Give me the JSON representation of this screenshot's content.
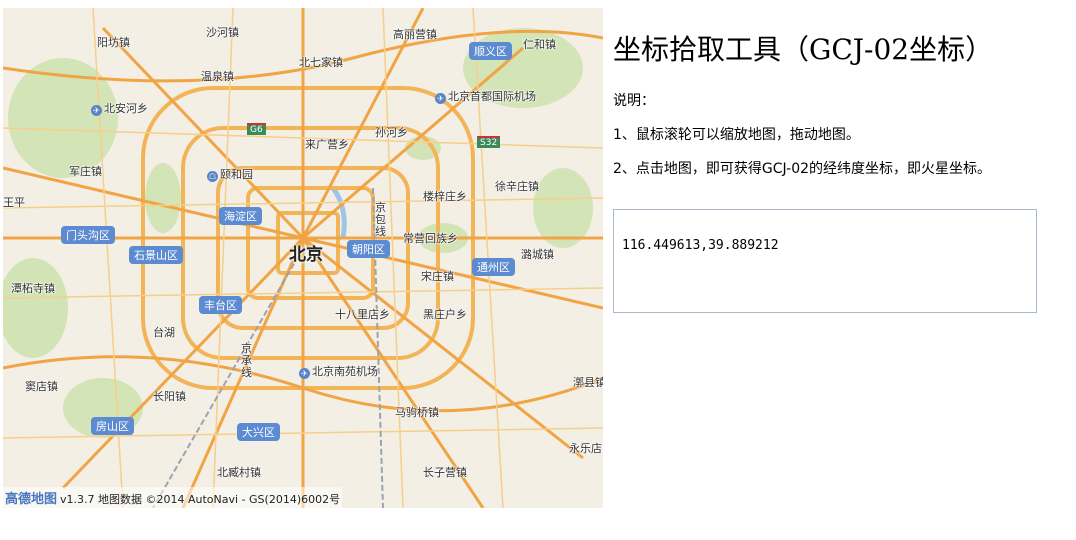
{
  "title": "坐标拾取工具（GCJ-02坐标）",
  "description": {
    "heading": "说明：",
    "line1": "1、鼠标滚轮可以缩放地图，拖动地图。",
    "line2": "2、点击地图，即可获得GCJ-02的经纬度坐标，即火星坐标。"
  },
  "coordinate_output": "116.449613,39.889212",
  "map": {
    "city": "北京",
    "districts": [
      "顺义区",
      "海淀区",
      "朝阳区",
      "门头沟区",
      "石景山区",
      "通州区",
      "丰台区",
      "房山区",
      "大兴区"
    ],
    "places": [
      "沙河镇",
      "高丽营镇",
      "阳坊镇",
      "仁和镇",
      "北七家镇",
      "北安河乡",
      "北京首都国际机场",
      "孙河乡",
      "来广营乡",
      "温泉镇",
      "颐和园",
      "楼梓庄乡",
      "徐辛庄镇",
      "军庄镇",
      "王平",
      "常营回族乡",
      "宋庄镇",
      "潭柘寺镇",
      "十八里店乡",
      "黑庄户乡",
      "北京南苑机场",
      "长阳镇",
      "马驹桥镇",
      "窦店镇",
      "北臧村镇",
      "长子营镇",
      "永乐店",
      "漷县镇",
      "台湖",
      "潞城镇"
    ],
    "roads": [
      "G6",
      "S32",
      "京包线",
      "京承线"
    ],
    "copyright": {
      "logo": "高德地图",
      "text": "v1.3.7 地图数据 ©2014 AutoNavi - GS(2014)6002号"
    }
  }
}
